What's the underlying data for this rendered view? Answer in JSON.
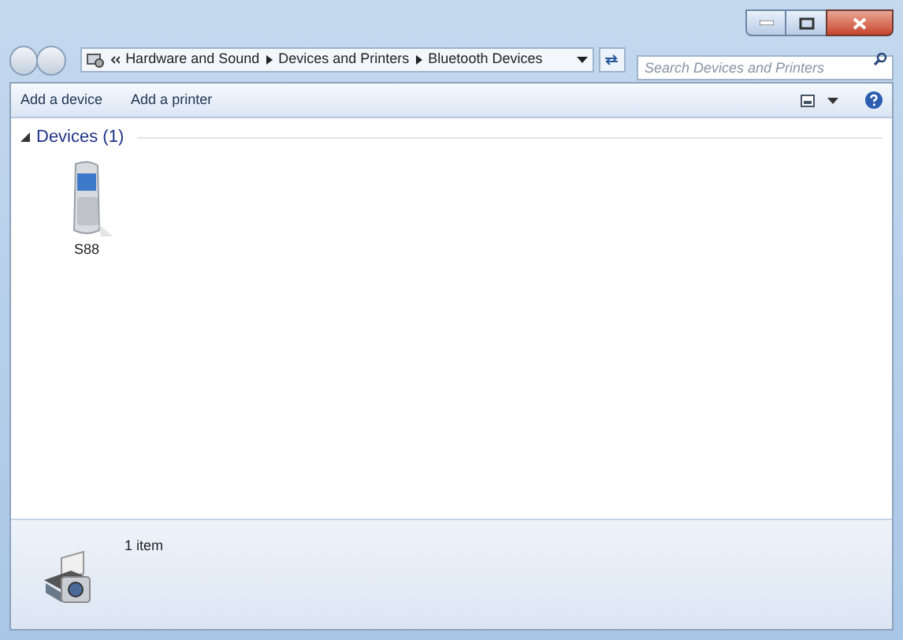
{
  "address_bar": {
    "breadcrumbs": [
      "Hardware and Sound",
      "Devices and Printers",
      "Bluetooth Devices"
    ]
  },
  "search": {
    "placeholder": "Search Devices and Printers"
  },
  "toolbar": {
    "buttons": [
      "Add a device",
      "Add a printer"
    ]
  },
  "groups": [
    {
      "title": "Devices (1)",
      "expanded": true,
      "items": [
        {
          "label": "S88"
        }
      ]
    }
  ],
  "details_pane": {
    "text": "1 item"
  }
}
